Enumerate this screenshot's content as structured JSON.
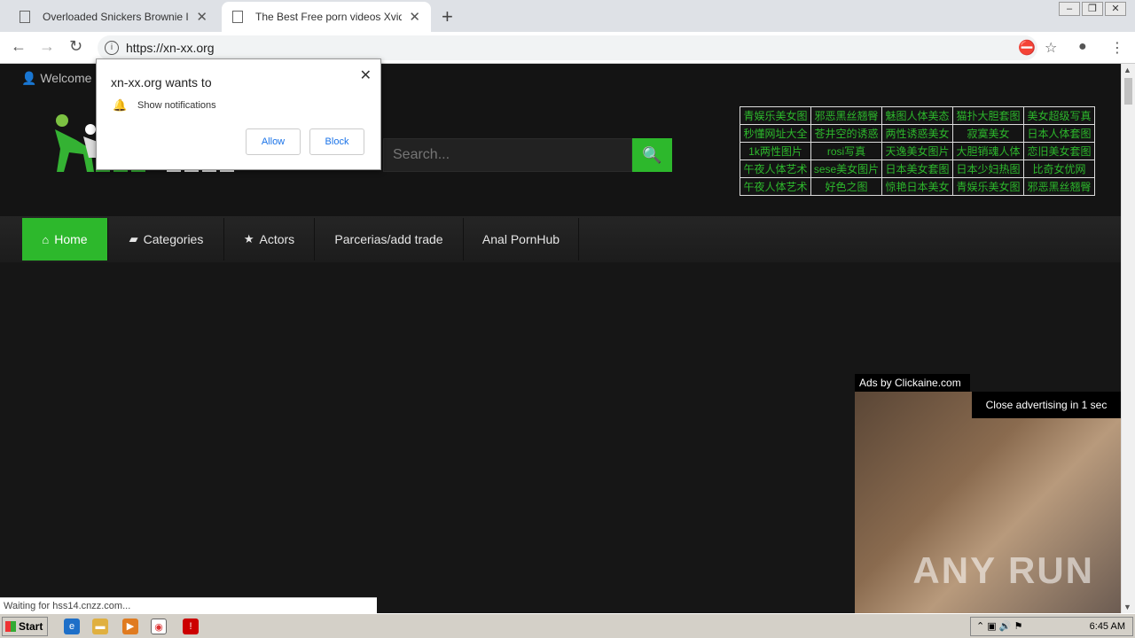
{
  "browser": {
    "tabs": [
      {
        "title": "Overloaded Snickers Brownie Is One"
      },
      {
        "title": "The Best Free porn videos Xvideos"
      }
    ],
    "url": "https://xn-xx.org",
    "status": "Waiting for hss14.cnzz.com..."
  },
  "site": {
    "welcome": "Welcome C",
    "search_placeholder": "Search...",
    "cn_links": [
      [
        "青娱乐美女图",
        "邪恶黑丝翘臀",
        "魅图人体美态",
        "猫扑大胆套图",
        "美女超级写真"
      ],
      [
        "秒懂网址大全",
        "苍井空的诱惑",
        "两性诱惑美女",
        "寂寞美女",
        "日本人体套图"
      ],
      [
        "1k两性图片",
        "rosi写真",
        "天逸美女图片",
        "大胆销魂人体",
        "恋旧美女套图"
      ],
      [
        "午夜人体艺术",
        "sese美女图片",
        "日本美女套图",
        "日本少妇热图",
        "比奇女优网"
      ],
      [
        "午夜人体艺术",
        "好色之图",
        "惊艳日本美女",
        "青娱乐美女图",
        "邪恶黑丝翘臀"
      ]
    ],
    "nav": [
      {
        "label": "Home"
      },
      {
        "label": "Categories"
      },
      {
        "label": "Actors"
      },
      {
        "label": "Parcerias/add trade"
      },
      {
        "label": "Anal PornHub"
      }
    ]
  },
  "notification": {
    "title": "xn-xx.org wants to",
    "message": "Show notifications",
    "allow": "Allow",
    "block": "Block"
  },
  "ad": {
    "label": "Ads by Clickaine.com",
    "close_text": "Close advertising in 1 sec",
    "watermark": "ANY RUN"
  },
  "taskbar": {
    "start": "Start",
    "time": "6:45 AM"
  }
}
